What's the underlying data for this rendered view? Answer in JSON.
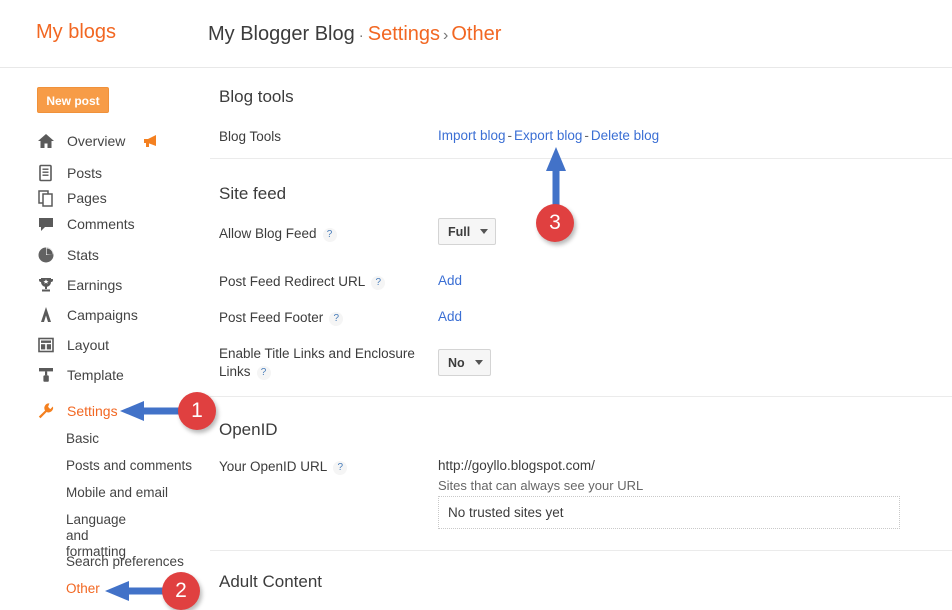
{
  "header": {
    "my_blogs_label": "My blogs",
    "blog_name": "My Blogger Blog",
    "dot": "·",
    "settings_label": "Settings",
    "separator": "›",
    "current_page": "Other"
  },
  "sidebar": {
    "new_post_label": "New post",
    "items": [
      {
        "label": "Overview",
        "icon": "home-icon",
        "badge_icon": "megaphone-icon"
      },
      {
        "label": "Posts",
        "icon": "posts-icon"
      },
      {
        "label": "Pages",
        "icon": "pages-icon"
      },
      {
        "label": "Comments",
        "icon": "comments-icon"
      },
      {
        "label": "Stats",
        "icon": "stats-pie-icon"
      },
      {
        "label": "Earnings",
        "icon": "trophy-icon"
      },
      {
        "label": "Campaigns",
        "icon": "campaigns-icon"
      },
      {
        "label": "Layout",
        "icon": "layout-icon"
      },
      {
        "label": "Template",
        "icon": "paint-roller-icon"
      },
      {
        "label": "Settings",
        "icon": "wrench-icon",
        "active": true
      }
    ],
    "sub_items": [
      {
        "label": "Basic"
      },
      {
        "label": "Posts and comments"
      },
      {
        "label": "Mobile and email"
      },
      {
        "label": "Language and formatting"
      },
      {
        "label": "Search preferences"
      },
      {
        "label": "Other",
        "active": true
      }
    ]
  },
  "main": {
    "sections": {
      "blog_tools": {
        "title": "Blog tools",
        "row_label": "Blog Tools",
        "import_link": "Import blog",
        "export_link": "Export blog",
        "delete_link": "Delete blog",
        "dash": "-"
      },
      "site_feed": {
        "title": "Site feed",
        "allow_blog_feed_label": "Allow Blog Feed",
        "allow_blog_feed_value": "Full",
        "post_feed_redirect_label": "Post Feed Redirect URL",
        "post_feed_redirect_action": "Add",
        "post_feed_footer_label": "Post Feed Footer",
        "post_feed_footer_action": "Add",
        "enable_title_links_label_line1": "Enable Title Links and Enclosure",
        "enable_title_links_label_line2": "Links",
        "enable_title_links_value": "No"
      },
      "openid": {
        "title": "OpenID",
        "your_openid_url_label": "Your OpenID URL",
        "openid_url_value": "http://goyllo.blogspot.com/",
        "trusted_sites_caption": "Sites that can always see your URL",
        "trusted_sites_empty": "No trusted sites yet"
      },
      "adult_content": {
        "title": "Adult Content"
      }
    },
    "help_icon_label": "?"
  },
  "annotations": [
    {
      "badge": "1",
      "target": "sidebar-settings",
      "direction": "left"
    },
    {
      "badge": "2",
      "target": "sidebar-other",
      "direction": "left"
    },
    {
      "badge": "3",
      "target": "export-blog-link",
      "direction": "up"
    }
  ],
  "colors": {
    "accent_orange": "#f26722",
    "link_blue": "#3b6fd4",
    "badge_red": "#e04040",
    "arrow_blue": "#4272c8"
  }
}
